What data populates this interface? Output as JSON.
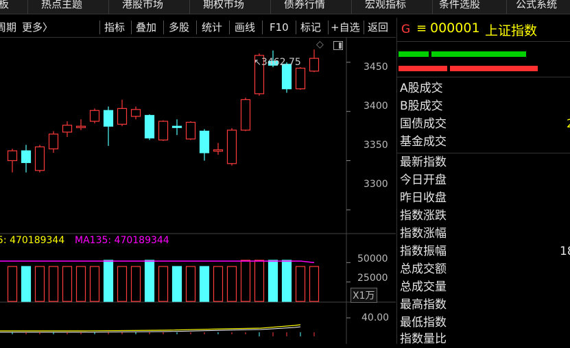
{
  "topnav": {
    "items": [
      "板",
      "热点主题",
      "港股市场",
      "期权市场",
      "债券行情",
      "宏观指标",
      "条件选股",
      "公式系统"
    ]
  },
  "toolbar": {
    "period_label": "周期",
    "more_label": "更多〉",
    "buttons": [
      "指标",
      "叠加",
      "多股",
      "统计",
      "画线",
      "F10",
      "标记",
      "+自选",
      "返回"
    ]
  },
  "chart": {
    "price_annotation": "3462.75",
    "price_axis": [
      "3450",
      "3400",
      "3350",
      "3300"
    ],
    "vol_axis": [
      "50000",
      "25000"
    ],
    "vol_unit": "X1万",
    "ind_axis": [
      "40.00"
    ],
    "vol_ma_a_label": "5: 470189344",
    "vol_ma_b_label": "MA135: 470189344",
    "colors": {
      "up": "#ff3b3b",
      "down": "#54ffff",
      "ma_a": "#ffff00",
      "ma_b": "#ff00ff"
    }
  },
  "chart_data": {
    "type": "candlestick",
    "price_ylim": [
      3280,
      3475
    ],
    "candles": [
      {
        "o": 3350,
        "c": 3360,
        "h": 3362,
        "l": 3338
      },
      {
        "o": 3360,
        "c": 3348,
        "h": 3366,
        "l": 3338
      },
      {
        "o": 3340,
        "c": 3364,
        "h": 3366,
        "l": 3338
      },
      {
        "o": 3362,
        "c": 3377,
        "h": 3380,
        "l": 3358
      },
      {
        "o": 3379,
        "c": 3386,
        "h": 3390,
        "l": 3374
      },
      {
        "o": 3384,
        "c": 3385,
        "h": 3392,
        "l": 3381
      },
      {
        "o": 3390,
        "c": 3401,
        "h": 3403,
        "l": 3388
      },
      {
        "o": 3401,
        "c": 3385,
        "h": 3405,
        "l": 3365
      },
      {
        "o": 3387,
        "c": 3403,
        "h": 3412,
        "l": 3385
      },
      {
        "o": 3395,
        "c": 3402,
        "h": 3405,
        "l": 3392
      },
      {
        "o": 3396,
        "c": 3373,
        "h": 3397,
        "l": 3371
      },
      {
        "o": 3371,
        "c": 3390,
        "h": 3391,
        "l": 3370
      },
      {
        "o": 3385,
        "c": 3384,
        "h": 3392,
        "l": 3376
      },
      {
        "o": 3372,
        "c": 3389,
        "h": 3390,
        "l": 3371
      },
      {
        "o": 3380,
        "c": 3358,
        "h": 3382,
        "l": 3350
      },
      {
        "o": 3360,
        "c": 3361,
        "h": 3368,
        "l": 3356
      },
      {
        "o": 3347,
        "c": 3381,
        "h": 3383,
        "l": 3345
      },
      {
        "o": 3381,
        "c": 3412,
        "h": 3414,
        "l": 3380
      },
      {
        "o": 3418,
        "c": 3457,
        "h": 3459,
        "l": 3416
      },
      {
        "o": 3451,
        "c": 3447,
        "h": 3462,
        "l": 3445
      },
      {
        "o": 3448,
        "c": 3423,
        "h": 3450,
        "l": 3419
      },
      {
        "o": 3423,
        "c": 3444,
        "h": 3445,
        "l": 3422
      },
      {
        "o": 3441,
        "c": 3454,
        "h": 3463,
        "l": 3440
      }
    ],
    "volume_ylim": [
      0,
      75000
    ],
    "volumes": [
      45000,
      45000,
      45000,
      45000,
      45000,
      45000,
      45000,
      53000,
      45000,
      45000,
      53000,
      45000,
      45000,
      45000,
      45000,
      45000,
      45000,
      53000,
      53000,
      53000,
      53000,
      45000,
      45000
    ],
    "ma_values": [
      52000,
      52000,
      52000,
      52000,
      52000,
      52000,
      52000,
      52000,
      52000,
      52000,
      52000,
      52000,
      52000,
      52000,
      52000,
      52000,
      52000,
      52000,
      52000,
      52000,
      52000,
      52000,
      50000
    ]
  },
  "quote": {
    "g_label": "G",
    "eq_label": "≡",
    "code": "000001",
    "name": "上证指数",
    "bars": {
      "green_pct": 0.75,
      "red_pct": 0.82
    },
    "rows_a": [
      "A股成交",
      "B股成交",
      "国债成交",
      "基金成交"
    ],
    "rows_a_values": [
      "",
      "",
      "2",
      ""
    ],
    "rows_b": [
      "最新指数",
      "今日开盘",
      "昨日收盘",
      "指数涨跌",
      "指数涨幅",
      "指数振幅",
      "总成交额",
      "总成交量",
      "最高指数",
      "最低指数",
      "指数量比"
    ],
    "rows_b_values": [
      "",
      "",
      "",
      "",
      "",
      "18",
      "",
      "",
      "",
      "",
      ""
    ]
  }
}
